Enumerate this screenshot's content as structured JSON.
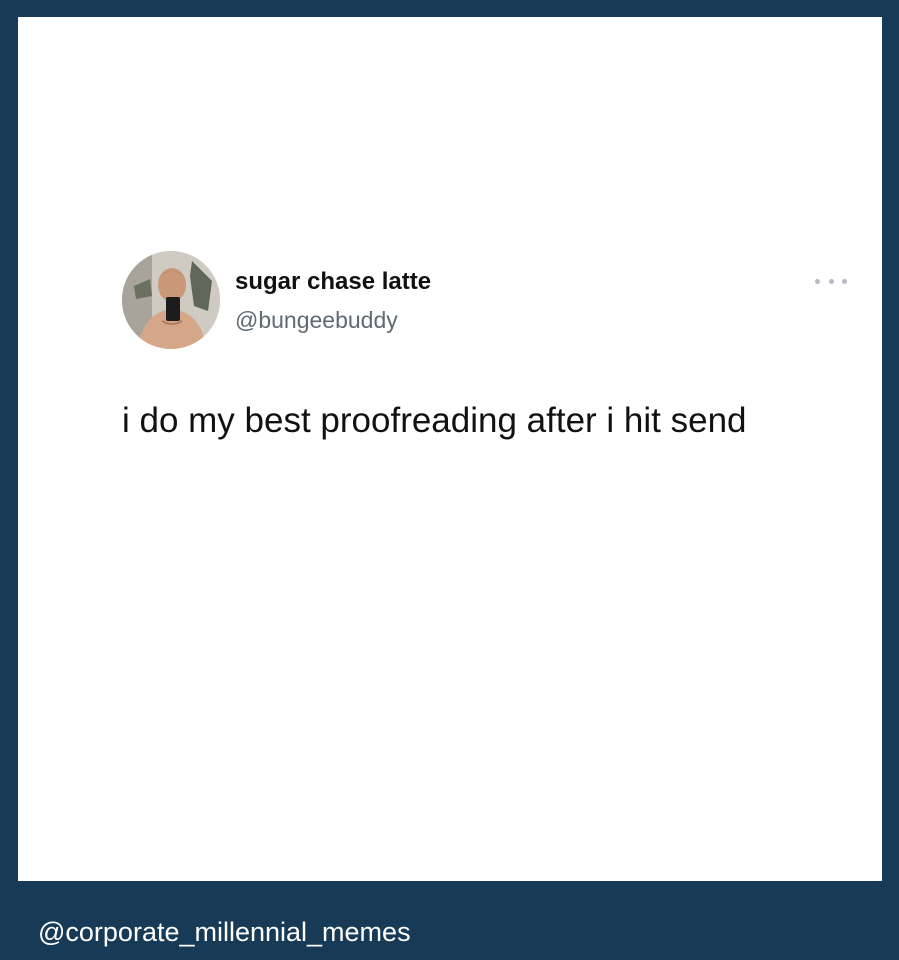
{
  "tweet": {
    "display_name": "sugar chase latte",
    "handle": "@bungeebuddy",
    "text": "i do my best proofreading after i hit send",
    "avatar_icon": "profile-photo",
    "more_icon": "more-options-icon"
  },
  "footer": {
    "watermark": "@corporate_millennial_memes"
  },
  "colors": {
    "background": "#173a56",
    "card": "#ffffff",
    "text": "#111111",
    "handle": "#5f6a74"
  }
}
